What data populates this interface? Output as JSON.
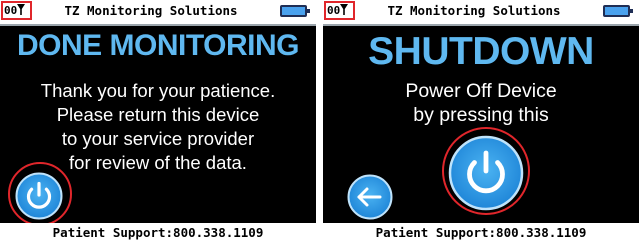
{
  "screens": [
    {
      "status": {
        "signal": "00"
      },
      "title": "TZ Monitoring Solutions",
      "headline": "DONE MONITORING",
      "message": [
        "Thank you for your patience.",
        "Please return this device",
        "to your service provider",
        "for review of the data."
      ],
      "footer": "Patient Support:800.338.1109",
      "icons": [
        "signal-icon",
        "battery-icon",
        "power-icon"
      ]
    },
    {
      "status": {
        "signal": "00"
      },
      "title": "TZ Monitoring Solutions",
      "headline": "SHUTDOWN",
      "message": [
        "Power Off Device",
        "by pressing this"
      ],
      "footer": "Patient Support:800.338.1109",
      "icons": [
        "signal-icon",
        "battery-icon",
        "back-arrow-icon",
        "power-icon"
      ]
    }
  ],
  "colors": {
    "accent": "#5fb8f0",
    "button_fill": "#2f9be6",
    "annotation": "#e0262b",
    "screen_bg": "#000000",
    "battery": "#4aa2ee"
  }
}
